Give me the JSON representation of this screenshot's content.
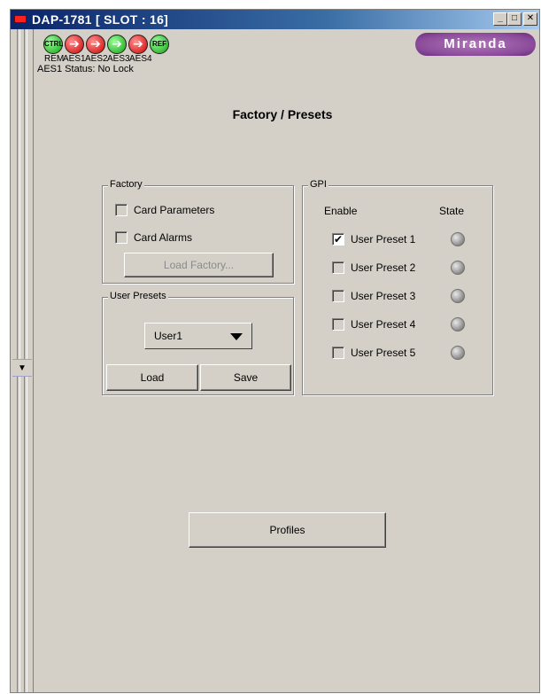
{
  "window": {
    "title": "DAP-1781 [ SLOT : 16]",
    "controls": {
      "minimize": "_",
      "maximize": "□",
      "close": "✕"
    }
  },
  "status_icons": [
    {
      "glyph": "CTRL",
      "label": "REM",
      "color": "green"
    },
    {
      "glyph": "➔",
      "label": "AES1",
      "color": "red"
    },
    {
      "glyph": "➔",
      "label": "AES2",
      "color": "red"
    },
    {
      "glyph": "➔",
      "label": "AES3",
      "color": "green"
    },
    {
      "glyph": "➔",
      "label": "AES4",
      "color": "red"
    },
    {
      "glyph": "REF",
      "label": "",
      "color": "green"
    }
  ],
  "logo": "Miranda",
  "status_line": "AES1 Status: No Lock",
  "page_title": "Factory / Presets",
  "factory": {
    "legend": "Factory",
    "card_parameters": {
      "label": "Card Parameters",
      "checked": false
    },
    "card_alarms": {
      "label": "Card Alarms",
      "checked": false
    },
    "load_factory_label": "Load Factory..."
  },
  "user_presets": {
    "legend": "User Presets",
    "selected": "User1",
    "load_label": "Load",
    "save_label": "Save"
  },
  "gpi": {
    "legend": "GPI",
    "enable_header": "Enable",
    "state_header": "State",
    "presets": [
      {
        "label": "User Preset 1",
        "checked": true,
        "checkmark": "✔"
      },
      {
        "label": "User Preset 2",
        "checked": false,
        "checkmark": ""
      },
      {
        "label": "User Preset 3",
        "checked": false,
        "checkmark": ""
      },
      {
        "label": "User Preset 4",
        "checked": false,
        "checkmark": ""
      },
      {
        "label": "User Preset 5",
        "checked": false,
        "checkmark": ""
      }
    ]
  },
  "profiles_label": "Profiles",
  "collapse_arrow": "▼",
  "colors": {
    "panel_bg": "#d4d0c8",
    "title_bar": "#0a246a",
    "led_green": "#10a010",
    "led_red": "#d00000",
    "brand": "#8a4a9a"
  }
}
